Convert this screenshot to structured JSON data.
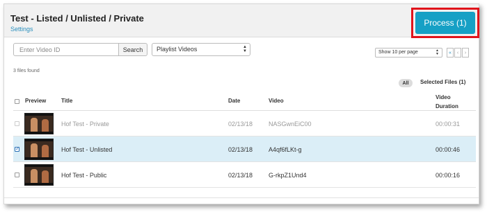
{
  "header": {
    "title": "Test - Listed / Unlisted / Private",
    "settings_link": "Settings",
    "process_button": "Process (1)"
  },
  "search": {
    "placeholder": "Enter Video ID",
    "button": "Search"
  },
  "playlist_select": {
    "value": "Playlist Videos"
  },
  "perpage_select": {
    "value": "Show 10 per page"
  },
  "pager": {
    "first": "«",
    "prev": "‹",
    "next": "›"
  },
  "files_found": "3 files found",
  "filters": {
    "all": "All",
    "selected": "Selected Files (1)"
  },
  "table": {
    "headers": {
      "preview": "Preview",
      "title": "Title",
      "date": "Date",
      "video": "Video",
      "duration_line1": "Video",
      "duration_line2": "Duration"
    },
    "rows": [
      {
        "title": "Hof Test - Private",
        "date": "02/13/18",
        "video": "NASGwnEiC00",
        "duration": "00:00:31",
        "checked": false,
        "disabled": true
      },
      {
        "title": "Hof Test - Unlisted",
        "date": "02/13/18",
        "video": "A4qf6fLKt-g",
        "duration": "00:00:46",
        "checked": true,
        "disabled": false
      },
      {
        "title": "Hof Test - Public",
        "date": "02/13/18",
        "video": "G-rkpZ1Und4",
        "duration": "00:00:16",
        "checked": false,
        "disabled": false
      }
    ]
  },
  "colors": {
    "accent": "#16a0c5",
    "highlight_border": "#e0131b",
    "selected_row": "#dbeef7",
    "link": "#2a8fbd"
  }
}
